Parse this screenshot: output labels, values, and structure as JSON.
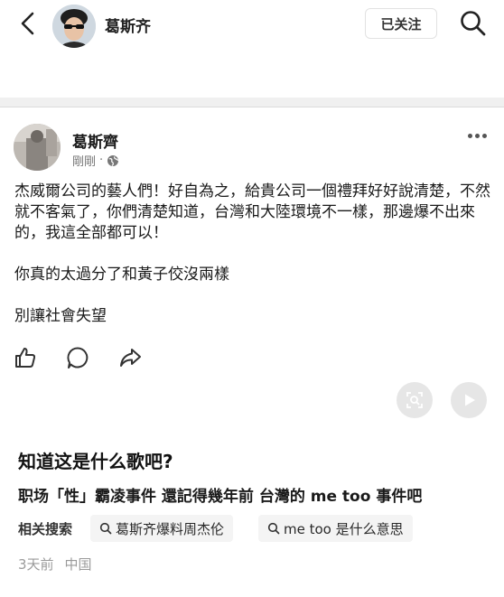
{
  "header": {
    "author_name": "葛斯齐",
    "follow_label": "已关注"
  },
  "post": {
    "author_name": "葛斯齊",
    "time": "剛剛",
    "separator": "·",
    "paragraphs": [
      "杰威爾公司的藝人們！好自為之，給貴公司一個禮拜好好說清楚，不然就不客氣了，你們清楚知道，台灣和大陸環境不一樣，那邊爆不出來的，我這全部都可以！",
      "你真的太過分了和黃子佼沒兩樣",
      "別讓社會失望"
    ]
  },
  "related": {
    "title": "知道这是什么歌吧?",
    "subtitle": "职场「性」霸凌事件 還記得幾年前 台灣的 me too 事件吧",
    "label": "相关搜索",
    "chips": [
      "葛斯齐爆料周杰伦",
      "me too 是什么意思"
    ]
  },
  "footer": {
    "time": "3天前",
    "location": "中国"
  },
  "colors": {
    "background": "#ffffff",
    "divider": "#f0f0f0",
    "chip_bg": "#f4f4f4",
    "meta_text": "#9a9a9a"
  }
}
